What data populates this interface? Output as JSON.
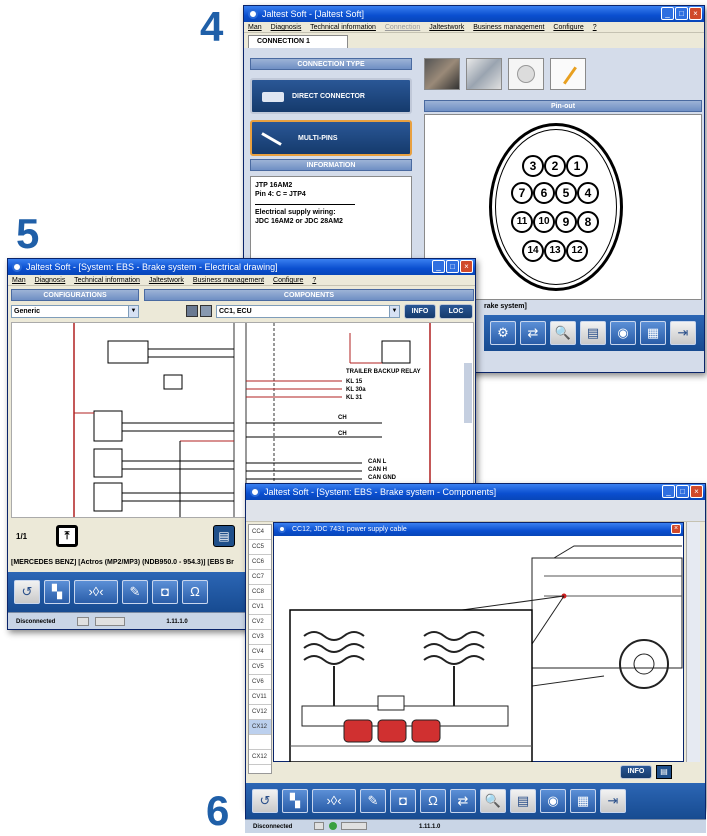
{
  "steps": {
    "four": "4",
    "five": "5",
    "six": "6"
  },
  "window4": {
    "title": "Jaltest Soft - [Jaltest Soft]",
    "menu": [
      "Man",
      "Diagnosis",
      "Technical information",
      "Connection",
      "Jaltestwork",
      "Business management",
      "Configure",
      "?"
    ],
    "tab": "CONNECTION 1",
    "connection_type_header": "CONNECTION TYPE",
    "direct_connector": "DIRECT CONNECTOR",
    "multi_pins": "MULTI-PINS",
    "information_header": "INFORMATION",
    "info_line1": "JTP 16AM2",
    "info_line2": "Pin 4: C = JTP4",
    "info_line3": "Electrical supply wiring:",
    "info_line4": "JDC 16AM2  or  JDC 28AM2",
    "pinout_header": "Pin-out",
    "pins_row1": [
      "3",
      "2",
      "1"
    ],
    "pins_row2": [
      "7",
      "6",
      "5",
      "4"
    ],
    "pins_row3": [
      "11",
      "10",
      "9",
      "8"
    ],
    "pins_row4": [
      "14",
      "13",
      "12"
    ],
    "crumb_tail": "rake system]"
  },
  "window5": {
    "title": "Jaltest Soft - [System: EBS - Brake system - Electrical drawing]",
    "menu": [
      "Man",
      "Diagnosis",
      "Technical information",
      "Jaltestwork",
      "Business management",
      "Configure",
      "?"
    ],
    "configurations_header": "CONFIGURATIONS",
    "components_header": "COMPONENTS",
    "config_value": "Generic",
    "component_value": "CC1, ECU",
    "info_btn": "INFO",
    "loc_btn": "LOC",
    "labels": [
      "TRAILER BACKUP RELAY",
      "KL 15",
      "KL 30a",
      "KL 31",
      "CH",
      "CH",
      "CAN L",
      "CAN H",
      "CAN GND"
    ],
    "page_counter": "1/1",
    "vehicle_crumb": "[MERCEDES BENZ] [Actros (MP2/MP3) (NDB950.0 - 954.3)] [EBS Br",
    "status": "Disconnected",
    "version": "1.11.1.0"
  },
  "window6": {
    "title": "Jaltest Soft - [System: EBS - Brake system - Components]",
    "dialog_title": "CC12, JDC 7431 power supply cable",
    "list": [
      "CC4",
      "CC5",
      "CC6",
      "CC7",
      "CC8",
      "CV1",
      "CV2",
      "CV3",
      "CV4",
      "CV5",
      "CV6",
      "CV11",
      "CV12",
      "CX12",
      "",
      "CX12"
    ],
    "info_btn": "INFO",
    "status": "Disconnected",
    "version": "1.11.1.0"
  },
  "colors": {
    "accent_blue": "#1f5fa8",
    "toolbar_blue": "#174b91",
    "wire_red": "#b02020"
  }
}
